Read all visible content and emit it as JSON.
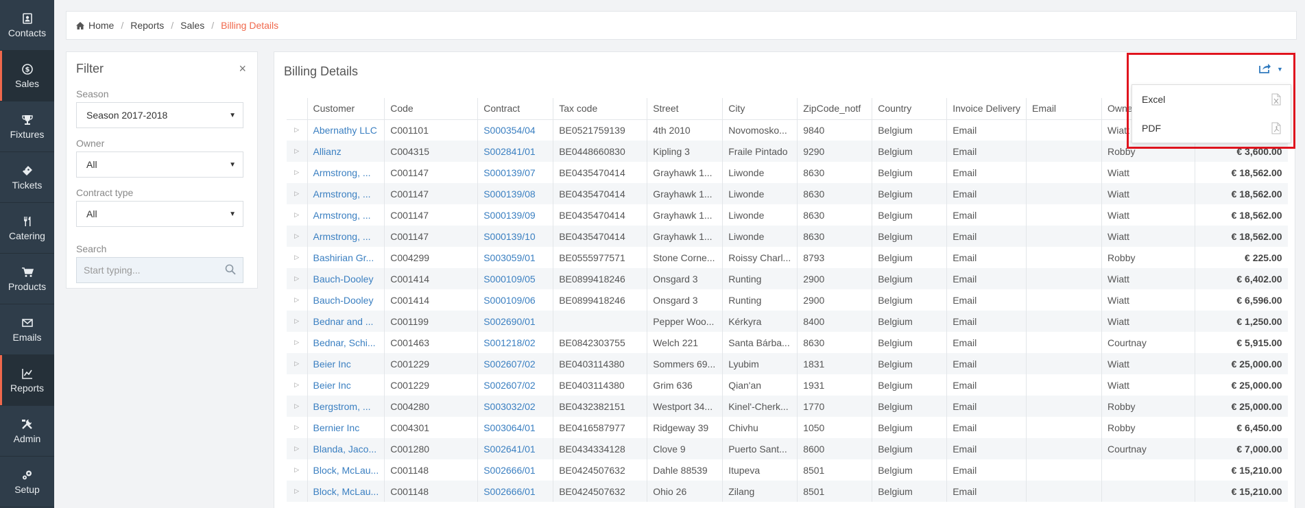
{
  "sidebar": {
    "items": [
      {
        "label": "Contacts",
        "icon": "contacts-icon",
        "active": false
      },
      {
        "label": "Sales",
        "icon": "dollar-icon",
        "active": true
      },
      {
        "label": "Fixtures",
        "icon": "trophy-icon",
        "active": false
      },
      {
        "label": "Tickets",
        "icon": "ticket-icon",
        "active": false
      },
      {
        "label": "Catering",
        "icon": "cutlery-icon",
        "active": false
      },
      {
        "label": "Products",
        "icon": "cart-icon",
        "active": false
      },
      {
        "label": "Emails",
        "icon": "envelope-icon",
        "active": false
      },
      {
        "label": "Reports",
        "icon": "chart-icon",
        "active": true
      },
      {
        "label": "Admin",
        "icon": "tools-icon",
        "active": false
      },
      {
        "label": "Setup",
        "icon": "gear-icon",
        "active": false
      }
    ]
  },
  "breadcrumb": {
    "home": "Home",
    "reports": "Reports",
    "sales": "Sales",
    "current": "Billing Details"
  },
  "filter": {
    "title": "Filter",
    "close": "×",
    "season_label": "Season",
    "season_value": "Season 2017-2018",
    "owner_label": "Owner",
    "owner_value": "All",
    "contract_type_label": "Contract type",
    "contract_type_value": "All",
    "search_label": "Search",
    "search_placeholder": "Start typing..."
  },
  "main": {
    "title": "Billing Details",
    "columns": [
      "Customer",
      "Code",
      "Contract",
      "Tax code",
      "Street",
      "City",
      "ZipCode_notf",
      "Country",
      "Invoice Delivery",
      "Email",
      "Owner",
      ""
    ],
    "rows": [
      [
        "Abernathy LLC",
        "C001101",
        "S000354/04",
        "BE0521759139",
        "4th 2010",
        "Novomosko...",
        "9840",
        "Belgium",
        "Email",
        "",
        "Wiatt",
        ""
      ],
      [
        "Allianz",
        "C004315",
        "S002841/01",
        "BE0448660830",
        "Kipling 3",
        "Fraile Pintado",
        "9290",
        "Belgium",
        "Email",
        "",
        "Robby",
        "€ 3,600.00"
      ],
      [
        "Armstrong, ...",
        "C001147",
        "S000139/07",
        "BE0435470414",
        "Grayhawk 1...",
        "Liwonde",
        "8630",
        "Belgium",
        "Email",
        "",
        "Wiatt",
        "€ 18,562.00"
      ],
      [
        "Armstrong, ...",
        "C001147",
        "S000139/08",
        "BE0435470414",
        "Grayhawk 1...",
        "Liwonde",
        "8630",
        "Belgium",
        "Email",
        "",
        "Wiatt",
        "€ 18,562.00"
      ],
      [
        "Armstrong, ...",
        "C001147",
        "S000139/09",
        "BE0435470414",
        "Grayhawk 1...",
        "Liwonde",
        "8630",
        "Belgium",
        "Email",
        "",
        "Wiatt",
        "€ 18,562.00"
      ],
      [
        "Armstrong, ...",
        "C001147",
        "S000139/10",
        "BE0435470414",
        "Grayhawk 1...",
        "Liwonde",
        "8630",
        "Belgium",
        "Email",
        "",
        "Wiatt",
        "€ 18,562.00"
      ],
      [
        "Bashirian Gr...",
        "C004299",
        "S003059/01",
        "BE0555977571",
        "Stone Corne...",
        "Roissy Charl...",
        "8793",
        "Belgium",
        "Email",
        "",
        "Robby",
        "€ 225.00"
      ],
      [
        "Bauch-Dooley",
        "C001414",
        "S000109/05",
        "BE0899418246",
        "Onsgard 3",
        "Runting",
        "2900",
        "Belgium",
        "Email",
        "",
        "Wiatt",
        "€ 6,402.00"
      ],
      [
        "Bauch-Dooley",
        "C001414",
        "S000109/06",
        "BE0899418246",
        "Onsgard 3",
        "Runting",
        "2900",
        "Belgium",
        "Email",
        "",
        "Wiatt",
        "€ 6,596.00"
      ],
      [
        "Bednar and ...",
        "C001199",
        "S002690/01",
        "",
        "Pepper Woo...",
        "Kérkyra",
        "8400",
        "Belgium",
        "Email",
        "",
        "Wiatt",
        "€ 1,250.00"
      ],
      [
        "Bednar, Schi...",
        "C001463",
        "S001218/02",
        "BE0842303755",
        "Welch 221",
        "Santa Bárba...",
        "8630",
        "Belgium",
        "Email",
        "",
        "Courtnay",
        "€ 5,915.00"
      ],
      [
        "Beier Inc",
        "C001229",
        "S002607/02",
        "BE0403114380",
        "Sommers 69...",
        "Lyubim",
        "1831",
        "Belgium",
        "Email",
        "",
        "Wiatt",
        "€ 25,000.00"
      ],
      [
        "Beier Inc",
        "C001229",
        "S002607/02",
        "BE0403114380",
        "Grim 636",
        "Qian'an",
        "1931",
        "Belgium",
        "Email",
        "",
        "Wiatt",
        "€ 25,000.00"
      ],
      [
        "Bergstrom, ...",
        "C004280",
        "S003032/02",
        "BE0432382151",
        "Westport 34...",
        "Kinel'-Cherk...",
        "1770",
        "Belgium",
        "Email",
        "",
        "Robby",
        "€ 25,000.00"
      ],
      [
        "Bernier Inc",
        "C004301",
        "S003064/01",
        "BE0416587977",
        "Ridgeway 39",
        "Chivhu",
        "1050",
        "Belgium",
        "Email",
        "",
        "Robby",
        "€ 6,450.00"
      ],
      [
        "Blanda, Jaco...",
        "C001280",
        "S002641/01",
        "BE0434334128",
        "Clove 9",
        "Puerto Sant...",
        "8600",
        "Belgium",
        "Email",
        "",
        "Courtnay",
        "€ 7,000.00"
      ],
      [
        "Block, McLau...",
        "C001148",
        "S002666/01",
        "BE0424507632",
        "Dahle 88539",
        "Itupeva",
        "8501",
        "Belgium",
        "Email",
        "",
        "",
        "€ 15,210.00"
      ],
      [
        "Block, McLau...",
        "C001148",
        "S002666/01",
        "BE0424507632",
        "Ohio 26",
        "Zilang",
        "8501",
        "Belgium",
        "Email",
        "",
        "",
        "€ 15,210.00"
      ]
    ]
  },
  "export": {
    "icon": "share-export-icon",
    "items": [
      {
        "label": "Excel",
        "icon": "excel-file-icon"
      },
      {
        "label": "PDF",
        "icon": "pdf-file-icon"
      }
    ]
  },
  "colors": {
    "sidebar_bg": "#2f3d4a",
    "accent": "#f0684c",
    "link": "#3a7fc1",
    "highlight": "#e0141e"
  }
}
